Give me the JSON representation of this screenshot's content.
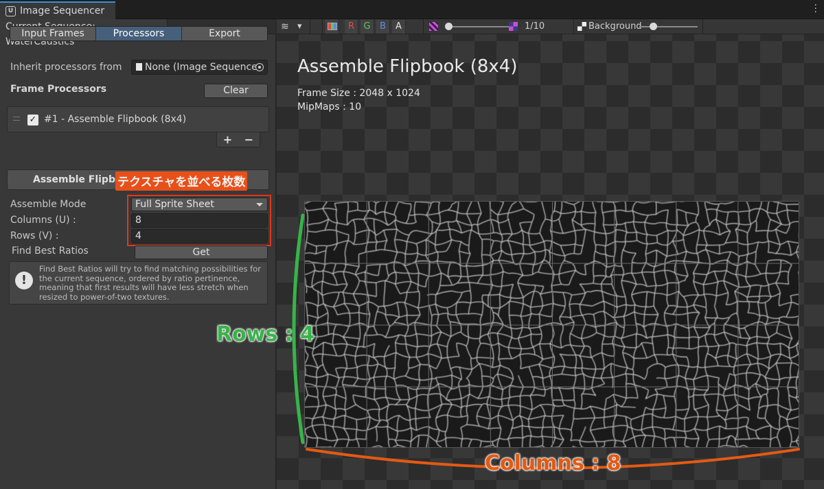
{
  "window": {
    "tab_title": "Image Sequencer",
    "icon": "unity-icon",
    "menu_icon": "kebab-menu-icon"
  },
  "sequence": {
    "label": "Current Sequence: WaterCaustics"
  },
  "tabs": [
    {
      "label": "Input Frames",
      "active": false
    },
    {
      "label": "Processors",
      "active": true
    },
    {
      "label": "Export",
      "active": false
    }
  ],
  "inherit": {
    "label": "Inherit processors from",
    "value": "None (Image Sequence"
  },
  "frame_processors": {
    "heading": "Frame Processors",
    "clear_label": "Clear",
    "items": [
      {
        "label": "#1 - Assemble Flipbook (8x4)",
        "checked": true
      }
    ],
    "add_label": "+",
    "remove_label": "−"
  },
  "section": {
    "header": "Assemble Flipbo"
  },
  "fields": {
    "mode_label": "Assemble Mode",
    "mode_value": "Full Sprite Sheet",
    "columns_label": "Columns (U) :",
    "columns_value": "8",
    "rows_label": "Rows (V) :",
    "rows_value": "4",
    "ratios_label": "Find Best Ratios",
    "get_label": "Get"
  },
  "help": {
    "icon": "info-icon",
    "text": "Find Best Ratios will try to find matching possibilities for the current sequence, ordered by ratio pertinence, meaning that first results will have less stretch when resized to power-of-two textures."
  },
  "toolbar": {
    "channels": [
      "R",
      "G",
      "B",
      "A"
    ],
    "channel_colors": {
      "R": "#e04a4a",
      "G": "#5fc45f",
      "B": "#5a8fe0",
      "A": "#e6e6e6"
    },
    "frame_counter": "1/10",
    "background_label": "Background"
  },
  "viewport": {
    "title": "Assemble Flipbook (8x4)",
    "frame_size": "Frame Size : 2048 x 1024",
    "mipmaps": "MipMaps : 10"
  },
  "annotations": {
    "callout": "テクスチャを並べる枚数",
    "rows": "Rows : 4",
    "columns": "Columns : 8"
  },
  "grid": {
    "columns": 8,
    "rows": 4
  }
}
